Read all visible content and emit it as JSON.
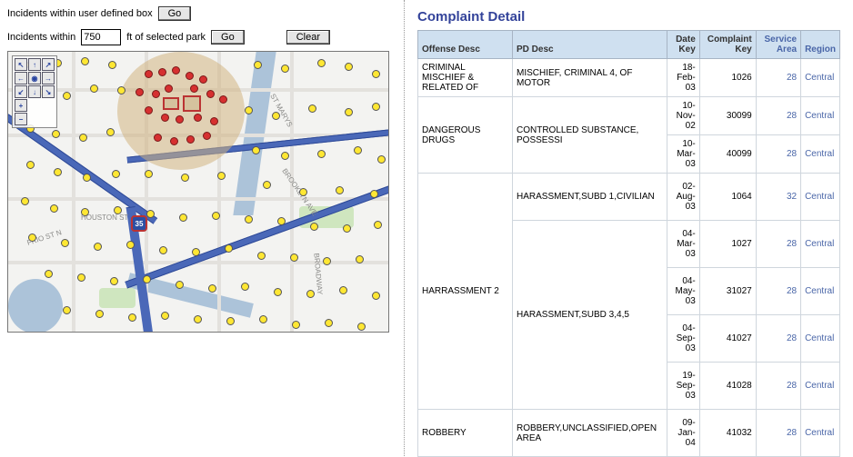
{
  "controls": {
    "box_label": "Incidents within user defined box",
    "go_label": "Go",
    "dist_label_pre": "Incidents within",
    "dist_value": "750",
    "dist_label_post": "ft of selected park",
    "go2_label": "Go",
    "clear_label": "Clear"
  },
  "map": {
    "shield_label": "35",
    "road_labels": {
      "frio": "FRIO ST N",
      "brooklyn": "BROOKLYN AVE",
      "broadway": "BROADWAY",
      "houston": "HOUSTON ST",
      "stmarys": "ST MARYS"
    },
    "nav": {
      "nw": "↖",
      "n": "↑",
      "ne": "↗",
      "w": "←",
      "home": "◉",
      "e": "→",
      "sw": "↙",
      "s": "↓",
      "se": "↘",
      "plus": "+",
      "minus": "−"
    }
  },
  "detail": {
    "title": "Complaint Detail",
    "columns": {
      "offense": "Offense Desc",
      "pd": "PD Desc",
      "date": "Date Key",
      "complaint": "Complaint Key",
      "area": "Service Area",
      "region": "Region"
    },
    "rows": [
      {
        "offense": "CRIMINAL MISCHIEF & RELATED OF",
        "pd": "MISCHIEF, CRIMINAL 4, OF MOTOR",
        "date": "18-Feb-03",
        "ck": "1026",
        "area": "28",
        "region": "Central",
        "off_rs": 1,
        "pd_rs": 1
      },
      {
        "offense": "DANGEROUS DRUGS",
        "pd": "CONTROLLED SUBSTANCE, POSSESSI",
        "date": "10-Nov-02",
        "ck": "30099",
        "area": "28",
        "region": "Central",
        "off_rs": 2,
        "pd_rs": 2
      },
      {
        "offense": "",
        "pd": "",
        "date": "10-Mar-03",
        "ck": "40099",
        "area": "28",
        "region": "Central",
        "off_rs": 0,
        "pd_rs": 0
      },
      {
        "offense": "HARRASSMENT 2",
        "pd": "HARASSMENT,SUBD 1,CIVILIAN",
        "date": "02-Aug-03",
        "ck": "1064",
        "area": "32",
        "region": "Central",
        "off_rs": 5,
        "pd_rs": 1,
        "tall": true
      },
      {
        "offense": "",
        "pd": "HARASSMENT,SUBD 3,4,5",
        "date": "04-Mar-03",
        "ck": "1027",
        "area": "28",
        "region": "Central",
        "off_rs": 0,
        "pd_rs": 4,
        "tall": true
      },
      {
        "offense": "",
        "pd": "",
        "date": "04-May-03",
        "ck": "31027",
        "area": "28",
        "region": "Central",
        "off_rs": 0,
        "pd_rs": 0,
        "tall": true
      },
      {
        "offense": "",
        "pd": "",
        "date": "04-Sep-03",
        "ck": "41027",
        "area": "28",
        "region": "Central",
        "off_rs": 0,
        "pd_rs": 0,
        "tall": true
      },
      {
        "offense": "",
        "pd": "",
        "date": "19-Sep-03",
        "ck": "41028",
        "area": "28",
        "region": "Central",
        "off_rs": 0,
        "pd_rs": 0,
        "tall": true
      },
      {
        "offense": "ROBBERY",
        "pd": "ROBBERY,UNCLASSIFIED,OPEN AREA",
        "date": "09-Jan-04",
        "ck": "41032",
        "area": "28",
        "region": "Central",
        "off_rs": 1,
        "pd_rs": 1,
        "tall": true
      }
    ]
  }
}
